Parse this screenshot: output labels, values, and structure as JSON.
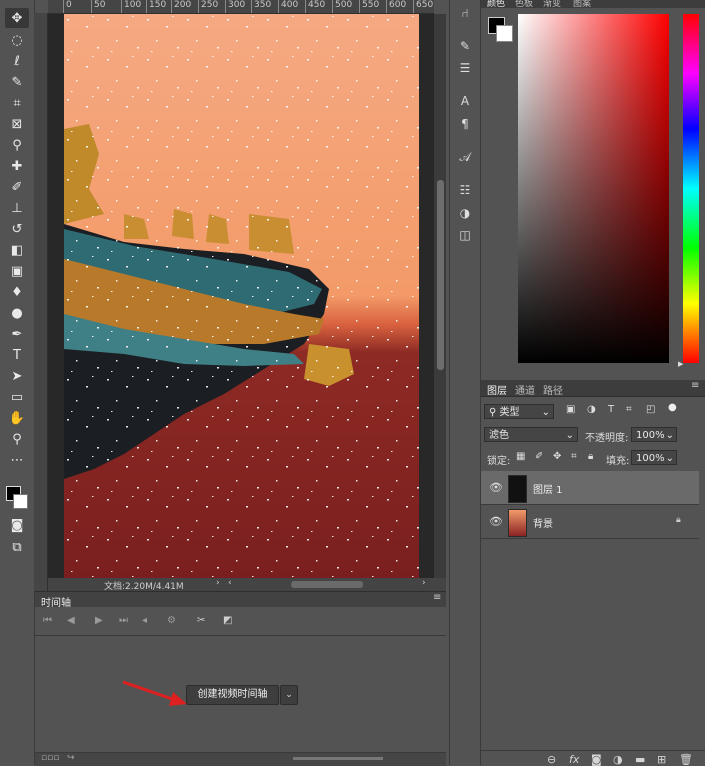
{
  "toolbar": {
    "tools": [
      "move-icon",
      "marquee-icon",
      "lasso-icon",
      "quick-select-icon",
      "crop-icon",
      "frame-icon",
      "eyedropper-icon",
      "healing-icon",
      "brush-icon",
      "stamp-icon",
      "history-brush-icon",
      "eraser-icon",
      "gradient-icon",
      "blur-icon",
      "dodge-icon",
      "pen-icon",
      "type-icon",
      "path-select-icon",
      "rectangle-icon",
      "hand-icon",
      "zoom-icon",
      "more-icon"
    ],
    "type_label": "T"
  },
  "ruler": {
    "ticks": [
      "0",
      "50",
      "100",
      "150",
      "200",
      "250",
      "300",
      "350",
      "400",
      "450",
      "500",
      "550",
      "600",
      "650"
    ]
  },
  "status": {
    "doc_text": "文档:2.20M/4.41M"
  },
  "timeline": {
    "tab_label": "时间轴",
    "create_button": "创建视频时间轴"
  },
  "color_panel": {
    "tabs": [
      "颜色",
      "色板",
      "渐变",
      "图案"
    ],
    "fg_color": "#000000",
    "bg_color": "#ffffff"
  },
  "layers_panel": {
    "tabs": [
      "图层",
      "通道",
      "路径"
    ],
    "filter_kind": "类型",
    "blend_mode": "滤色",
    "opacity_label": "不透明度:",
    "opacity_value": "100%",
    "lock_label": "锁定:",
    "fill_label": "填充:",
    "fill_value": "100%",
    "layers": [
      {
        "name": "图层 1",
        "selected": true
      },
      {
        "name": "背景",
        "selected": false,
        "locked": true
      }
    ]
  }
}
